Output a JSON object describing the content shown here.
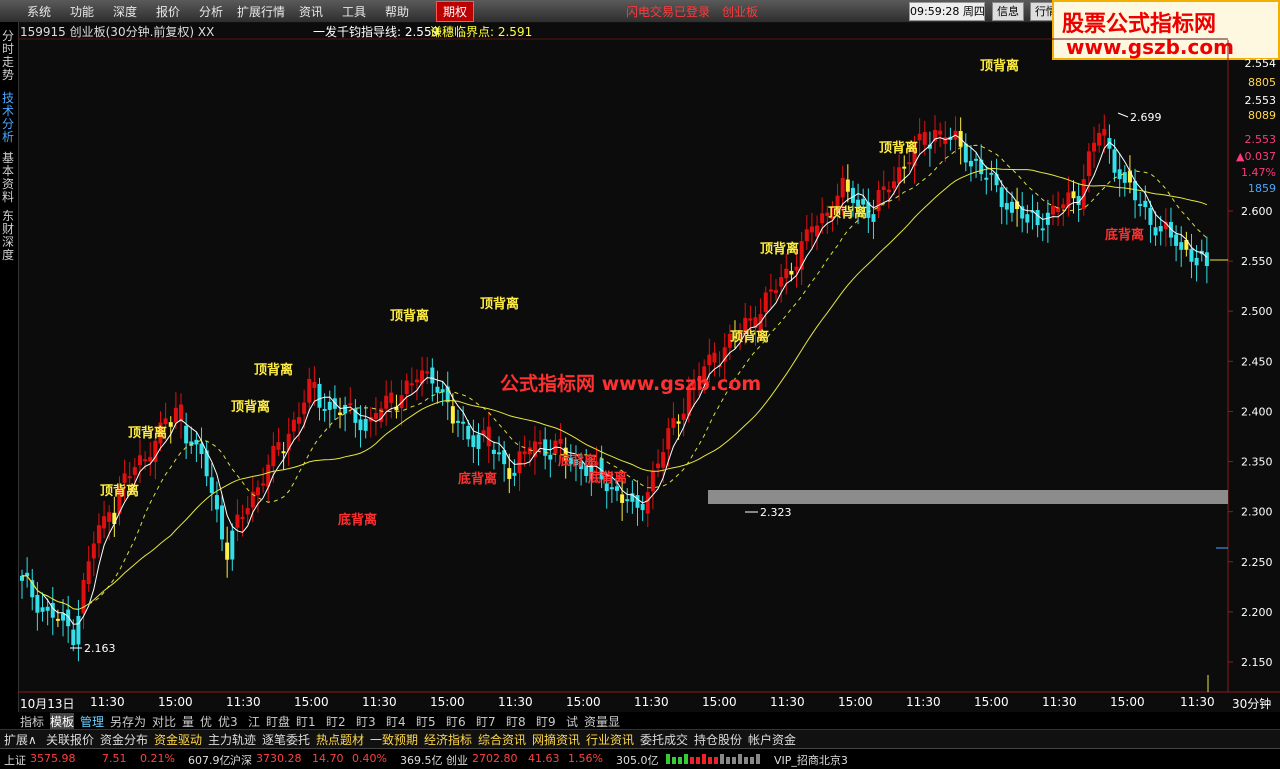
{
  "menu": [
    "系统",
    "功能",
    "深度",
    "报价",
    "分析",
    "扩展行情",
    "资讯",
    "工具",
    "帮助"
  ],
  "menu_active": "期权",
  "menu_status": "闪电交易已登录",
  "menu_board": "创业板",
  "clock": {
    "time": "09:59:28",
    "weekday": "周四"
  },
  "top_buttons": [
    "信息",
    "行情"
  ],
  "ad": {
    "line1": "股票公式指标网",
    "line2": "www.gszb.com"
  },
  "side_tabs": [
    {
      "label": "分时走势"
    },
    {
      "label": "技术分析",
      "selected": true
    },
    {
      "label": "基本资料"
    },
    {
      "label": "东财深度"
    }
  ],
  "title": "159915 创业板(30分钟.前复权) XX",
  "indicator": {
    "label1": "一发千钧指导线: 2.559",
    "label2": "谦穗临界点: 2.591"
  },
  "watermark": "公式指标网 www.gszb.com",
  "right_axis": {
    "price_top": "2.554",
    "vol_top": "8805",
    "price2": "2.553",
    "vol2": "8089",
    "cur_price": "2.553",
    "change": "▲0.037",
    "change_pct": "1.47%",
    "volume": "1859",
    "ticks": [
      "2.600",
      "2.550",
      "2.500",
      "2.450",
      "2.400",
      "2.350",
      "2.300",
      "2.250",
      "2.200",
      "2.150"
    ]
  },
  "annotations": {
    "top_div": "顶背离",
    "bottom_div": "底背离",
    "low_label": "2.163",
    "high_label": "2.699",
    "support_label": "2.323"
  },
  "x_axis": [
    "10月13日",
    "11:30",
    "15:00",
    "11:30",
    "15:00",
    "11:30",
    "15:00",
    "11:30",
    "15:00",
    "11:30",
    "15:00",
    "11:30",
    "15:00",
    "11:30",
    "15:00",
    "11:30",
    "15:00",
    "11:30"
  ],
  "period": "30分钟",
  "bottom_tabs": [
    "指标",
    "模板",
    "管理",
    "另存为",
    "对比",
    "量",
    "优",
    "优3",
    "江",
    "盯盘",
    "盯1",
    "盯2",
    "盯3",
    "盯4",
    "盯5",
    "盯6",
    "盯7",
    "盯8",
    "盯9",
    "试",
    "资量显"
  ],
  "bottom_tabs_selected": "模板",
  "func_tabs": [
    {
      "label": "扩展∧",
      "hl": false
    },
    {
      "label": "关联报价",
      "hl": false
    },
    {
      "label": "资金分布",
      "hl": false
    },
    {
      "label": "资金驱动",
      "hl": true
    },
    {
      "label": "主力轨迹",
      "hl": false
    },
    {
      "label": "逐笔委托",
      "hl": false
    },
    {
      "label": "热点题材",
      "hl": true
    },
    {
      "label": "一致预期",
      "hl": true
    },
    {
      "label": "经济指标",
      "hl": true
    },
    {
      "label": "综合资讯",
      "hl": true
    },
    {
      "label": "网摘资讯",
      "hl": true
    },
    {
      "label": "行业资讯",
      "hl": true
    },
    {
      "label": "委托成交",
      "hl": false
    },
    {
      "label": "持仓股份",
      "hl": false
    },
    {
      "label": "帐户资金",
      "hl": false
    }
  ],
  "status_bar": {
    "sh_name": "上证",
    "sh_val": "3575.98",
    "sh_chg": "7.51",
    "sh_pct": "0.21%",
    "sh_amt": "607.9亿",
    "hs_name": "沪深",
    "hs_val": "3730.28",
    "hs_chg": "14.70",
    "hs_pct": "0.40%",
    "hs_amt": "369.5亿",
    "cy_name": "创业",
    "cy_val": "2702.80",
    "cy_chg": "41.63",
    "cy_pct": "1.56%",
    "cy_amt": "305.0亿",
    "broker": "VIP_招商北京3"
  },
  "colors": {
    "up": "#e01010",
    "down": "#33dfe8",
    "signal": "#ffee44",
    "bg": "#0c0c0c"
  }
}
